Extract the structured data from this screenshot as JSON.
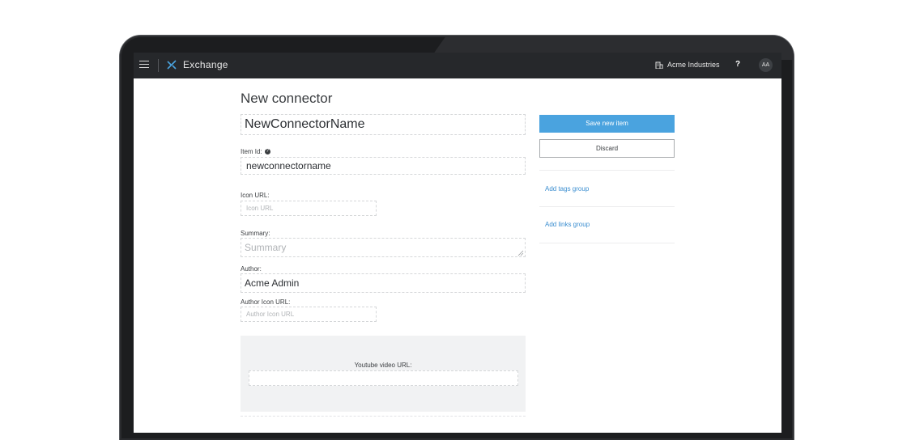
{
  "appbar": {
    "title": "Exchange",
    "org_name": "Acme Industries",
    "help_label": "?",
    "avatar_initials": "AA"
  },
  "form": {
    "title": "New connector",
    "name_value": "NewConnectorName",
    "item_id_label": "Item Id:",
    "item_id_help": "?",
    "item_id_value": "newconnectorname",
    "icon_url_label": "Icon URL:",
    "icon_url_placeholder": "Icon URL",
    "summary_label": "Summary:",
    "summary_placeholder": "Summary",
    "author_label": "Author:",
    "author_value": "Acme Admin",
    "author_icon_label": "Author Icon URL:",
    "author_icon_placeholder": "Author Icon URL",
    "video_label": "Youtube video URL:"
  },
  "sidebar": {
    "save_label": "Save new item",
    "discard_label": "Discard",
    "add_tags_label": "Add tags group",
    "add_links_label": "Add links group"
  },
  "colors": {
    "accent": "#4aa3df",
    "link": "#3b8ed0",
    "appbar_bg": "#26282b"
  },
  "icons": [
    "menu-icon",
    "exchange-logo-icon",
    "building-icon",
    "help-icon"
  ]
}
